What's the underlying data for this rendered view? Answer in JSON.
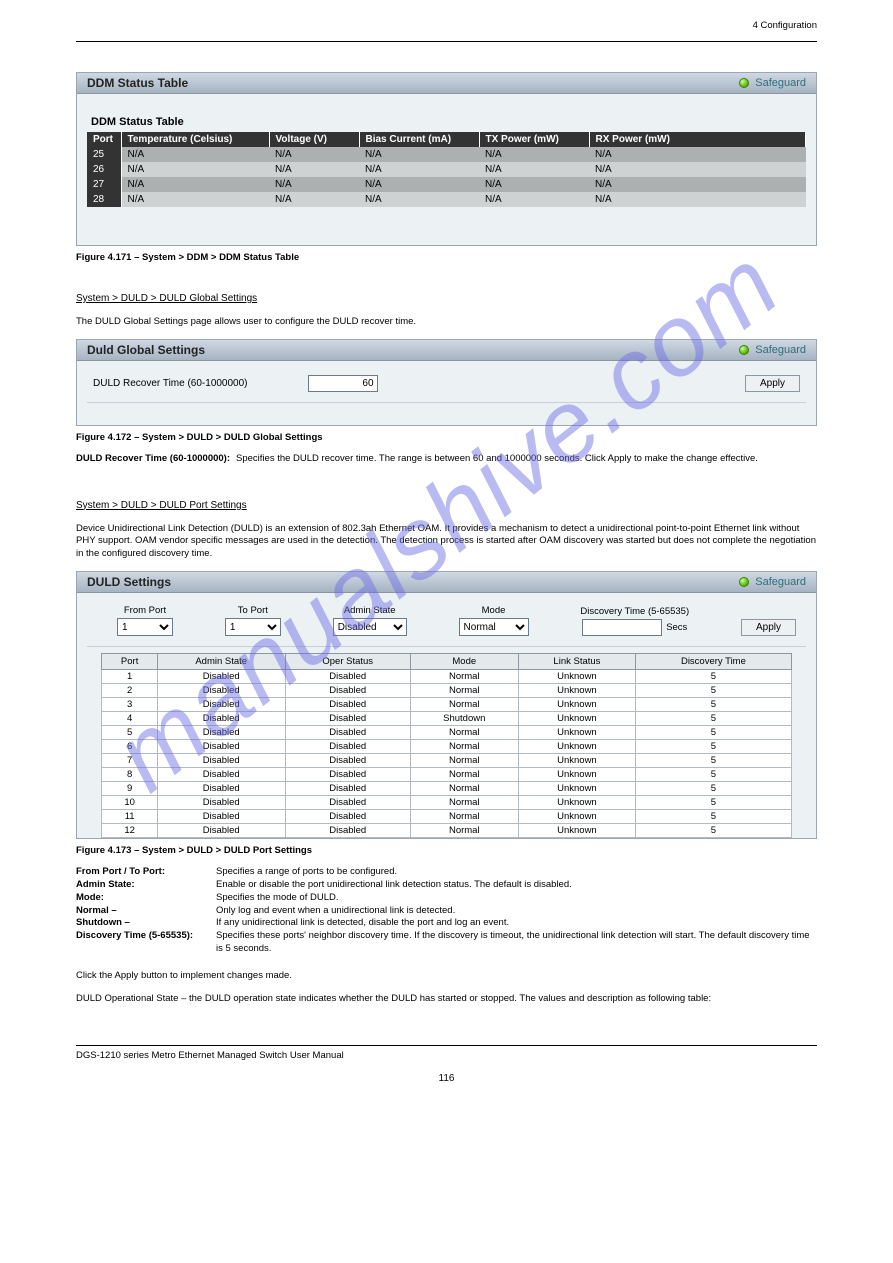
{
  "header_right": "4 Configuration",
  "watermark": "manualshive.com",
  "doc_title": "DGS-1210 series Metro Ethernet Managed Switch User Manual",
  "page_number": "116",
  "fig1": {
    "panel_title": "DDM Status Table",
    "safeguard": "Safeguard",
    "table_title": "DDM Status Table",
    "headers": [
      "Port",
      "Temperature (Celsius)",
      "Voltage (V)",
      "Bias Current (mA)",
      "TX Power (mW)",
      "RX Power (mW)"
    ],
    "rows": [
      [
        "25",
        "N/A",
        "N/A",
        "N/A",
        "N/A",
        "N/A"
      ],
      [
        "26",
        "N/A",
        "N/A",
        "N/A",
        "N/A",
        "N/A"
      ],
      [
        "27",
        "N/A",
        "N/A",
        "N/A",
        "N/A",
        "N/A"
      ],
      [
        "28",
        "N/A",
        "N/A",
        "N/A",
        "N/A",
        "N/A"
      ]
    ],
    "caption": "Figure 4.171 – System > DDM > DDM Status Table"
  },
  "sec1": {
    "heading": "System > DULD > DULD Global Settings",
    "text": "The DULD Global Settings page allows user to configure the DULD recover time.",
    "panel_title": "Duld Global Settings",
    "safeguard": "Safeguard",
    "label": "DULD Recover Time (60-1000000)",
    "value": "60",
    "apply": "Apply",
    "caption": "Figure 4.172 – System > DULD > DULD Global Settings",
    "field_name": "DULD Recover Time (60-1000000):",
    "field_desc": "Specifies the DULD recover time. The range is between 60 and 1000000 seconds. Click Apply to make the change effective."
  },
  "sec2": {
    "heading": "System > DULD > DULD Port Settings",
    "text1": "Device Unidirectional Link Detection (DULD) is an extension of 802.3ah Ethernet OAM. It provides a mechanism to detect a unidirectional point-to-point Ethernet link without PHY support. OAM vendor specific messages are used in the detection. The detection process is started after OAM discovery was started but does not complete the negotiation in the configured discovery time.",
    "panel_title": "DULD Settings",
    "safeguard": "Safeguard",
    "form": {
      "from_port": "From Port",
      "to_port": "To Port",
      "admin_state": "Admin State",
      "mode": "Mode",
      "discovery_time": "Discovery Time (5-65535)",
      "secs": "Secs",
      "apply": "Apply",
      "from_port_val": "1",
      "to_port_val": "1",
      "admin_state_val": "Disabled",
      "mode_val": "Normal"
    },
    "table_headers": [
      "Port",
      "Admin State",
      "Oper Status",
      "Mode",
      "Link Status",
      "Discovery Time"
    ],
    "table_rows": [
      [
        "1",
        "Disabled",
        "Disabled",
        "Normal",
        "Unknown",
        "5"
      ],
      [
        "2",
        "Disabled",
        "Disabled",
        "Normal",
        "Unknown",
        "5"
      ],
      [
        "3",
        "Disabled",
        "Disabled",
        "Normal",
        "Unknown",
        "5"
      ],
      [
        "4",
        "Disabled",
        "Disabled",
        "Shutdown",
        "Unknown",
        "5"
      ],
      [
        "5",
        "Disabled",
        "Disabled",
        "Normal",
        "Unknown",
        "5"
      ],
      [
        "6",
        "Disabled",
        "Disabled",
        "Normal",
        "Unknown",
        "5"
      ],
      [
        "7",
        "Disabled",
        "Disabled",
        "Normal",
        "Unknown",
        "5"
      ],
      [
        "8",
        "Disabled",
        "Disabled",
        "Normal",
        "Unknown",
        "5"
      ],
      [
        "9",
        "Disabled",
        "Disabled",
        "Normal",
        "Unknown",
        "5"
      ],
      [
        "10",
        "Disabled",
        "Disabled",
        "Normal",
        "Unknown",
        "5"
      ],
      [
        "11",
        "Disabled",
        "Disabled",
        "Normal",
        "Unknown",
        "5"
      ],
      [
        "12",
        "Disabled",
        "Disabled",
        "Normal",
        "Unknown",
        "5"
      ]
    ],
    "caption": "Figure 4.173 – System > DULD > DULD Port Settings",
    "fields": [
      {
        "name": "From Port / To Port:",
        "desc": "Specifies a range of ports to be configured."
      },
      {
        "name": "Admin State:",
        "desc": "Enable or disable the port unidirectional link detection status. The default is disabled."
      },
      {
        "name": "Mode:",
        "desc": "Specifies the mode of DULD."
      },
      {
        "name": "Normal –",
        "desc": "Only log and event when a unidirectional link is detected."
      },
      {
        "name": "Shutdown –",
        "desc": "If any unidirectional link is detected, disable the port and log an event."
      },
      {
        "name": "Discovery Time (5-65535):",
        "desc": "Specifies these ports' neighbor discovery time. If the discovery is timeout, the unidirectional link detection will start. The default discovery time is 5 seconds."
      }
    ],
    "apply_line": "Click the Apply button to implement changes made.",
    "state_line": "DULD Operational State – the DULD operation state indicates whether the DULD has started or stopped. The values and description as following table:"
  }
}
